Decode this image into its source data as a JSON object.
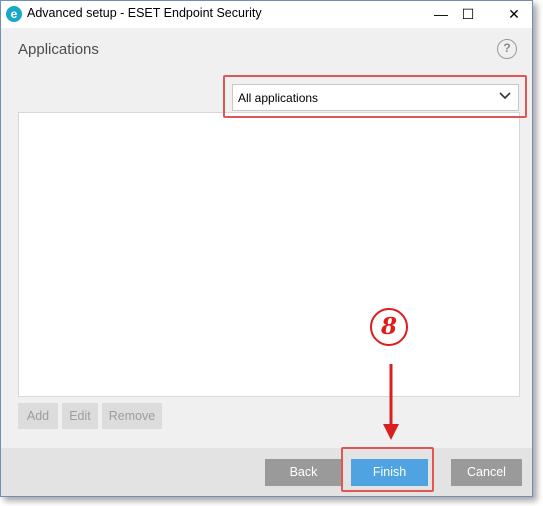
{
  "window": {
    "title": "Advanced setup - ESET Endpoint Security",
    "app_icon_letter": "e",
    "controls": {
      "minimize": "—",
      "maximize": "☐",
      "close": "✕"
    }
  },
  "header": {
    "title": "Applications",
    "help_symbol": "?"
  },
  "filter": {
    "selected": "All applications"
  },
  "list": {
    "items": []
  },
  "list_actions": {
    "add_label": "Add",
    "edit_label": "Edit",
    "remove_label": "Remove"
  },
  "footer": {
    "back_label": "Back",
    "finish_label": "Finish",
    "cancel_label": "Cancel"
  },
  "annotation": {
    "step_number": "8",
    "highlight_color": "#e05555"
  },
  "colors": {
    "accent": "#4fa3e0",
    "secondary_button": "#9a9a9a",
    "brand": "#1aa8c8"
  }
}
